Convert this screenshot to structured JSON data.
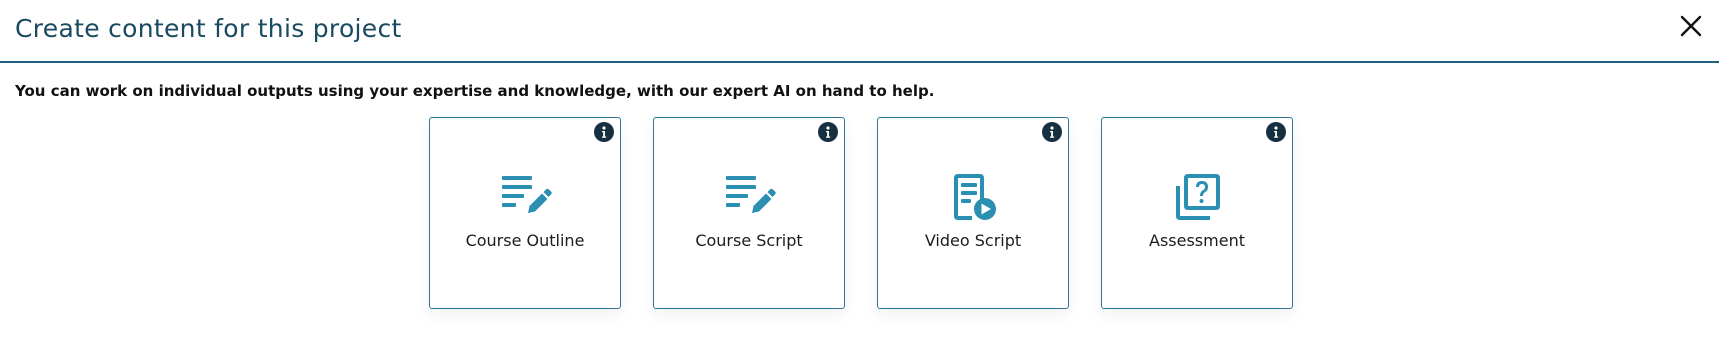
{
  "modal": {
    "title": "Create content for this project",
    "subtitle": "You can work on individual outputs using your expertise and knowledge, with our expert AI on hand to help."
  },
  "colors": {
    "accent": "#2a8fb1",
    "border": "#1d5f7e",
    "info_button": "#17303f"
  },
  "cards": [
    {
      "label": "Course Outline",
      "icon": "document-edit-icon"
    },
    {
      "label": "Course Script",
      "icon": "document-edit-icon"
    },
    {
      "label": "Video Script",
      "icon": "video-script-icon"
    },
    {
      "label": "Assessment",
      "icon": "quiz-icon"
    }
  ]
}
